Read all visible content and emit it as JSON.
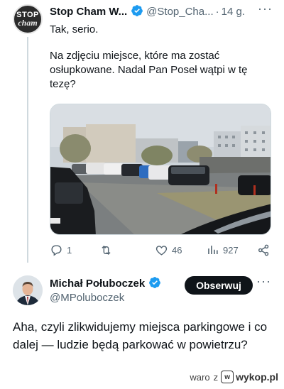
{
  "tweet": {
    "author_name": "Stop Cham W...",
    "handle": "@Stop_Cha...",
    "time": "14 g.",
    "text": "Tak, serio.",
    "quote_text": "Na zdjęciu miejsce, które ma zostać osłupkowane. Nadal Pan Poseł wątpi w tę tezę?",
    "avatar_logo_top": "STOP",
    "avatar_logo_bottom": "cham",
    "stats": {
      "replies": "1",
      "likes": "46",
      "views": "927"
    }
  },
  "reply": {
    "author_name": "Michał Połuboczek",
    "handle": "@MPoluboczek",
    "follow_label": "Obserwuj",
    "text": "Aha, czyli zlikwidujemy miejsca parkingowe i co dalej — ludzie będą parkować w powietrzu?"
  },
  "watermark": {
    "user": "waro",
    "connector": "z",
    "site": "wykop.pl"
  },
  "colors": {
    "verified": "#1d9bf0",
    "muted": "#536471",
    "text": "#0f1419",
    "follow_bg": "#0f1419"
  },
  "icons": [
    "reply-icon",
    "retweet-icon",
    "like-icon",
    "views-icon",
    "share-icon",
    "verified-badge-icon",
    "more-icon"
  ]
}
